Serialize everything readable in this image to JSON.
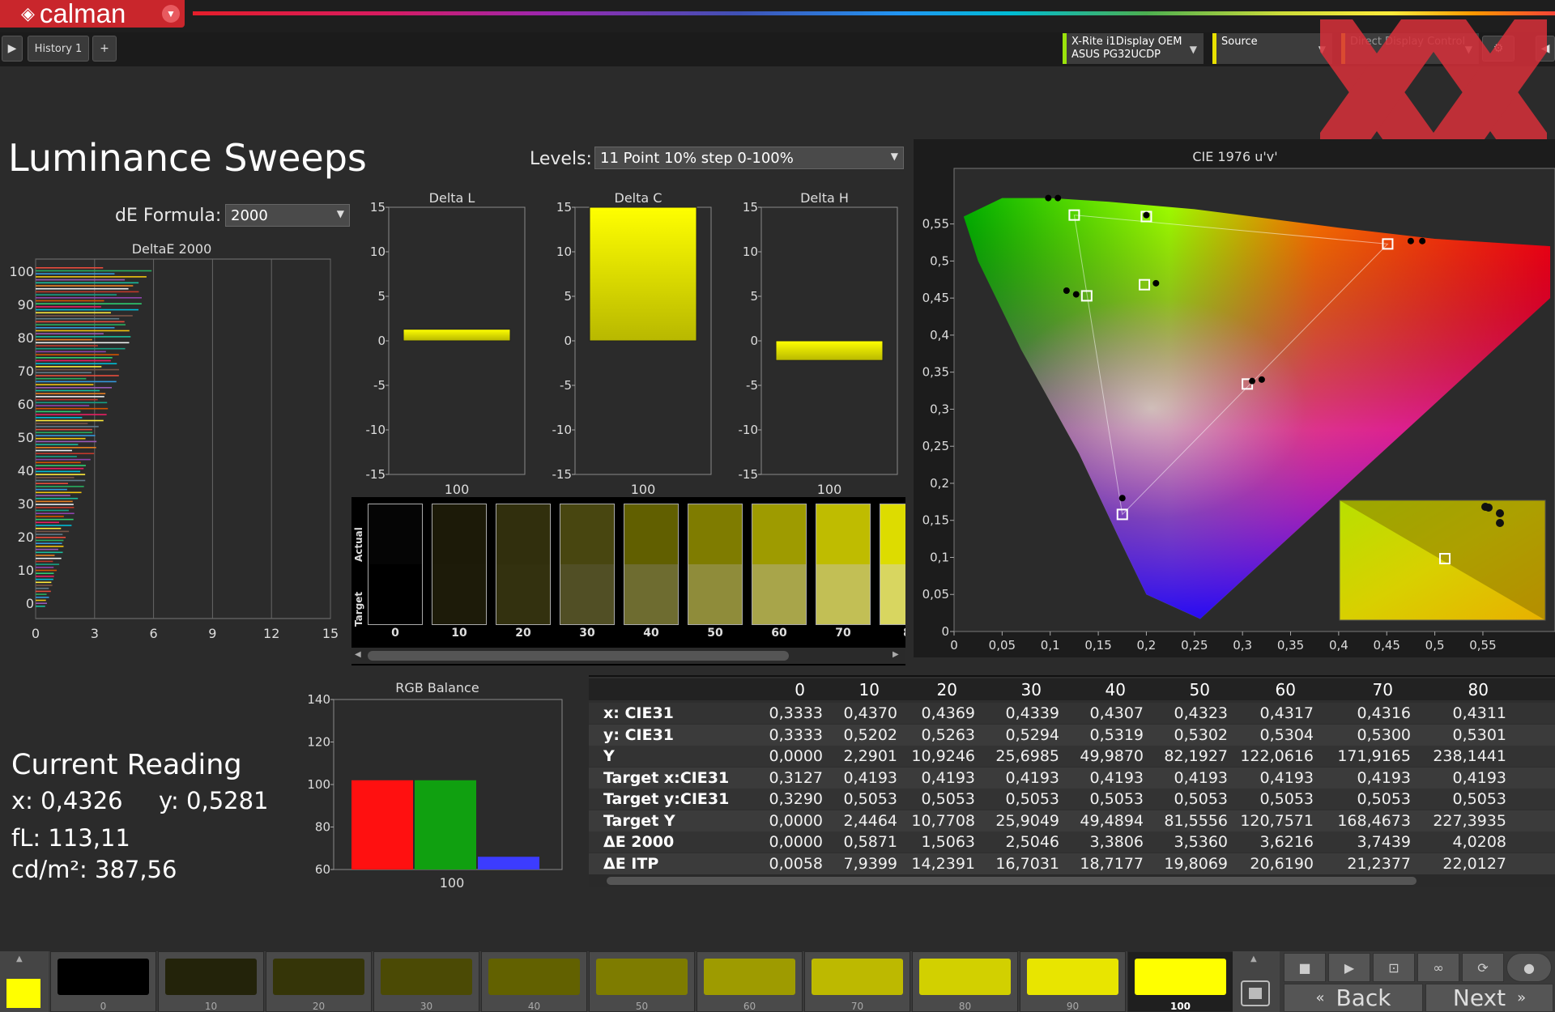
{
  "app": {
    "name": "calman",
    "tab": "History 1",
    "add_tab": "+"
  },
  "meters": [
    {
      "line1": "X-Rite i1Display OEM",
      "line2": "ASUS PG32UCDP",
      "accent": "#9be30c"
    },
    {
      "line1": "Source",
      "line2": "",
      "accent": "#e8e000"
    },
    {
      "line1": "Direct Display Control",
      "line2": "",
      "accent": "#e8e000"
    }
  ],
  "page": {
    "title": "Luminance Sweeps",
    "levels_label": "Levels:",
    "levels_value": "11 Point 10% step 0-100%",
    "de_label": "dE Formula:",
    "de_value": "2000"
  },
  "colors": {
    "accent": "#c9262c",
    "yellow": "#ffff00",
    "panel": "#2b2b2b"
  },
  "deltae_chart": {
    "title": "DeltaE 2000",
    "y_ticks": [
      "100",
      "90",
      "80",
      "70",
      "60",
      "50",
      "40",
      "30",
      "20",
      "10",
      "0"
    ],
    "x_ticks": [
      "0",
      "3",
      "6",
      "9",
      "12",
      "15"
    ],
    "xlim": [
      0,
      15
    ],
    "ylim": [
      0,
      100
    ]
  },
  "delta_charts": [
    {
      "title": "Delta L",
      "value": 1.3,
      "x_label": "100",
      "y_ticks": [
        "15",
        "10",
        "5",
        "0",
        "-5",
        "-10",
        "-15"
      ]
    },
    {
      "title": "Delta C",
      "value": 15,
      "x_label": "100",
      "y_ticks": [
        "15",
        "10",
        "5",
        "0",
        "-5",
        "-10",
        "-15"
      ]
    },
    {
      "title": "Delta H",
      "value": -2.2,
      "x_label": "100",
      "y_ticks": [
        "15",
        "10",
        "5",
        "0",
        "-5",
        "-10",
        "-15"
      ]
    }
  ],
  "swatches": {
    "actual_label": "Actual",
    "target_label": "Target",
    "items": [
      {
        "label": "0",
        "actual": "#050505",
        "target": "#000000"
      },
      {
        "label": "10",
        "actual": "#1c1a08",
        "target": "#1d1b09"
      },
      {
        "label": "20",
        "actual": "#312f0d",
        "target": "#33310f"
      },
      {
        "label": "30",
        "actual": "#484610",
        "target": "#514f25"
      },
      {
        "label": "40",
        "actual": "#615f00",
        "target": "#6e6c30"
      },
      {
        "label": "50",
        "actual": "#7f7c00",
        "target": "#8f8c3a"
      },
      {
        "label": "60",
        "actual": "#9e9b00",
        "target": "#a8a54a"
      },
      {
        "label": "70",
        "actual": "#bfbc00",
        "target": "#c2bf55"
      },
      {
        "label": "8",
        "actual": "#dddc00",
        "target": "#d8d660"
      }
    ]
  },
  "cie": {
    "title": "CIE 1976 u'v'",
    "x_ticks": [
      "0",
      "0,05",
      "0,1",
      "0,15",
      "0,2",
      "0,25",
      "0,3",
      "0,35",
      "0,4",
      "0,45",
      "0,5",
      "0,55"
    ],
    "y_ticks": [
      "0,55",
      "0,5",
      "0,45",
      "0,4",
      "0,35",
      "0,3",
      "0,25",
      "0,2",
      "0,15",
      "0,1",
      "0,05",
      "0"
    ],
    "xlim": [
      0,
      0.6
    ],
    "ylim": [
      0,
      0.6
    ]
  },
  "rgb_balance": {
    "title": "RGB Balance",
    "y_ticks": [
      "140",
      "120",
      "100",
      "80",
      "60"
    ],
    "ylim": [
      60,
      140
    ],
    "x_label": "100",
    "red": 102,
    "green": 102,
    "blue": 66
  },
  "chart_data": [
    {
      "type": "bar",
      "title": "RGB Balance",
      "categories": [
        "100"
      ],
      "series": [
        {
          "name": "",
          "values": [
            102
          ]
        },
        {
          "name": "",
          "values": [
            102
          ]
        },
        {
          "name": "",
          "values": [
            66
          ]
        }
      ],
      "ylim": [
        60,
        140
      ]
    },
    {
      "type": "bar",
      "title": "Delta L",
      "categories": [
        "100"
      ],
      "values": [
        1.3
      ],
      "ylim": [
        -15,
        15
      ]
    },
    {
      "type": "bar",
      "title": "Delta C",
      "categories": [
        "100"
      ],
      "values": [
        15
      ],
      "ylim": [
        -15,
        15
      ]
    },
    {
      "type": "bar",
      "title": "Delta H",
      "categories": [
        "100"
      ],
      "values": [
        -2.2
      ],
      "ylim": [
        -15,
        15
      ]
    }
  ],
  "current_reading": {
    "title": "Current Reading",
    "x": "x: 0,4326",
    "y": "y: 0,5281",
    "fl": "fL: 113,11",
    "cdm2": "cd/m²: 387,56"
  },
  "table": {
    "columns": [
      "0",
      "10",
      "20",
      "30",
      "40",
      "50",
      "60",
      "70",
      "80"
    ],
    "rows": [
      {
        "label": "x: CIE31",
        "values": [
          "0,3333",
          "0,4370",
          "0,4369",
          "0,4339",
          "0,4307",
          "0,4323",
          "0,4317",
          "0,4316",
          "0,4311"
        ]
      },
      {
        "label": "y: CIE31",
        "values": [
          "0,3333",
          "0,5202",
          "0,5263",
          "0,5294",
          "0,5319",
          "0,5302",
          "0,5304",
          "0,5300",
          "0,5301"
        ]
      },
      {
        "label": "Y",
        "values": [
          "0,0000",
          "2,2901",
          "10,9246",
          "25,6985",
          "49,9870",
          "82,1927",
          "122,0616",
          "171,9165",
          "238,1441"
        ]
      },
      {
        "label": "Target x:CIE31",
        "values": [
          "0,3127",
          "0,4193",
          "0,4193",
          "0,4193",
          "0,4193",
          "0,4193",
          "0,4193",
          "0,4193",
          "0,4193"
        ]
      },
      {
        "label": "Target y:CIE31",
        "values": [
          "0,3290",
          "0,5053",
          "0,5053",
          "0,5053",
          "0,5053",
          "0,5053",
          "0,5053",
          "0,5053",
          "0,5053"
        ]
      },
      {
        "label": "Target Y",
        "values": [
          "0,0000",
          "2,4464",
          "10,7708",
          "25,9049",
          "49,4894",
          "81,5556",
          "120,7571",
          "168,4673",
          "227,3935"
        ]
      },
      {
        "label": "ΔE 2000",
        "values": [
          "0,0000",
          "0,5871",
          "1,5063",
          "2,5046",
          "3,3806",
          "3,5360",
          "3,6216",
          "3,7439",
          "4,0208"
        ]
      },
      {
        "label": "ΔE ITP",
        "values": [
          "0,0058",
          "7,9399",
          "14,2391",
          "16,7031",
          "18,7177",
          "19,8069",
          "20,6190",
          "21,2377",
          "22,0127"
        ]
      }
    ]
  },
  "footer": {
    "swatches": [
      {
        "label": "0",
        "color": "#000000"
      },
      {
        "label": "10",
        "color": "#23230a"
      },
      {
        "label": "20",
        "color": "#353508"
      },
      {
        "label": "30",
        "color": "#4b4a05"
      },
      {
        "label": "40",
        "color": "#626100"
      },
      {
        "label": "50",
        "color": "#7e7c00"
      },
      {
        "label": "60",
        "color": "#9e9b00"
      },
      {
        "label": "70",
        "color": "#bdb900"
      },
      {
        "label": "80",
        "color": "#d2d000"
      },
      {
        "label": "90",
        "color": "#e8e500"
      },
      {
        "label": "100",
        "color": "#ffff00"
      }
    ],
    "back": "Back",
    "next": "Next"
  }
}
